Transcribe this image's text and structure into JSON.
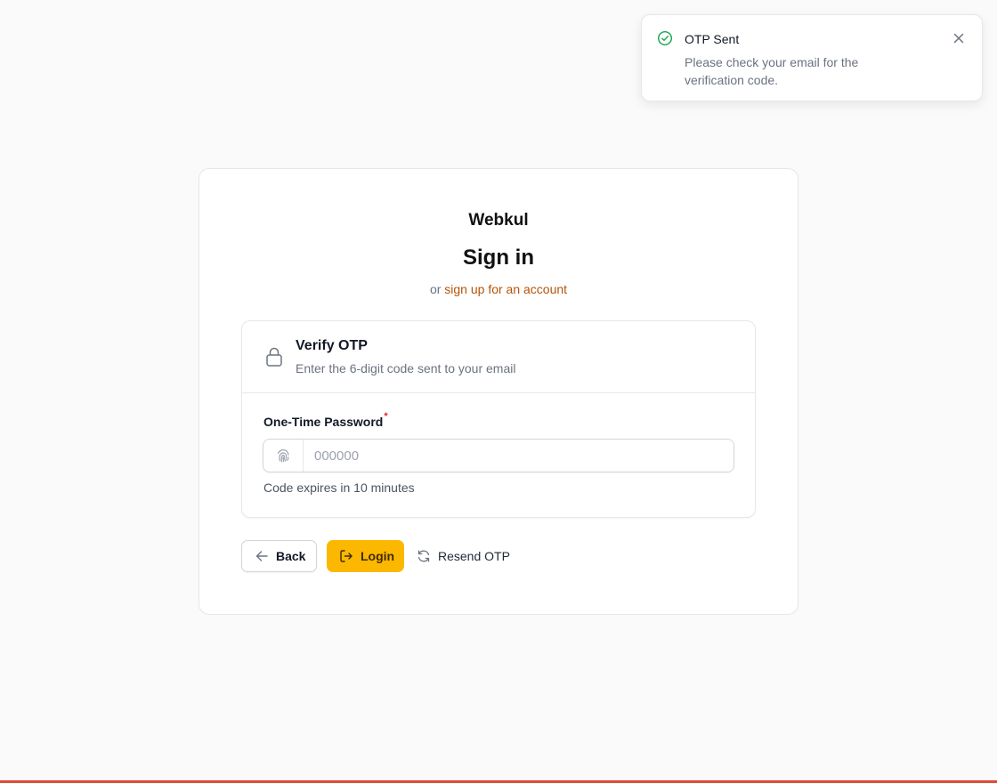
{
  "toast": {
    "title": "OTP Sent",
    "message": "Please check your email for the verification code.",
    "icon": "check-circle-icon",
    "close_icon": "close-icon",
    "accent_color": "#16a34a"
  },
  "header": {
    "brand": "Webkul",
    "title": "Sign in",
    "or_text": "or",
    "signup_link": "sign up for an account",
    "link_color": "#b45309"
  },
  "otp_panel": {
    "title": "Verify OTP",
    "description": "Enter the 6-digit code sent to your email",
    "icon": "lock-icon"
  },
  "otp_field": {
    "label": "One-Time Password",
    "required_mark": "*",
    "value": "",
    "placeholder": "000000",
    "icon": "fingerprint-icon",
    "hint": "Code expires in 10 minutes"
  },
  "actions": {
    "back_label": "Back",
    "login_label": "Login",
    "resend_label": "Resend OTP",
    "login_color": "#fcb800"
  },
  "footer": {
    "bar_color": "#dc4a38"
  }
}
